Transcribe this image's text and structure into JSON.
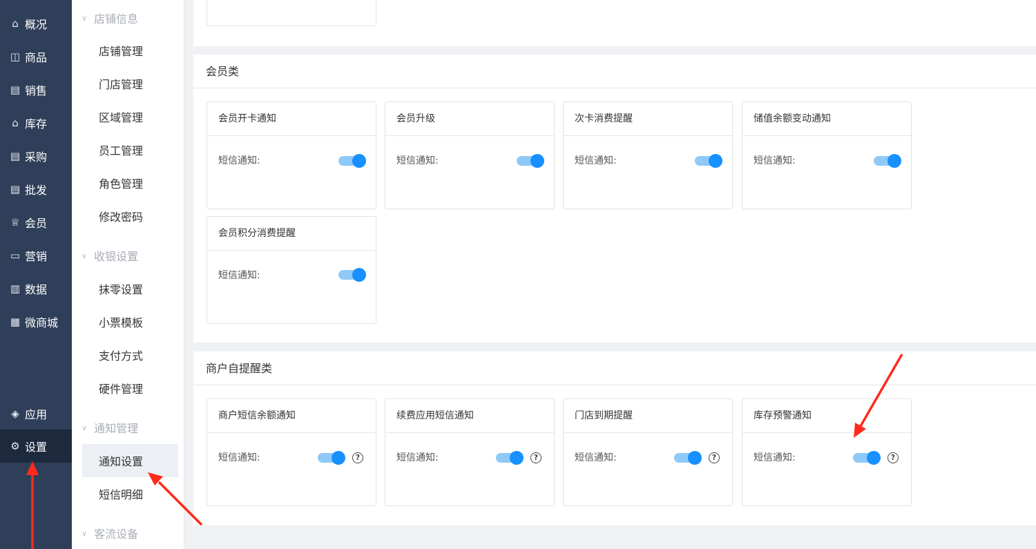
{
  "nav": {
    "items": [
      {
        "label": "概况",
        "icon": "overview-icon",
        "glyph": "⌂"
      },
      {
        "label": "商品",
        "icon": "bag-icon",
        "glyph": "◫"
      },
      {
        "label": "销售",
        "icon": "receipt-icon",
        "glyph": "▤"
      },
      {
        "label": "库存",
        "icon": "warehouse-icon",
        "glyph": "⌂"
      },
      {
        "label": "采购",
        "icon": "receipt-icon",
        "glyph": "▤"
      },
      {
        "label": "批发",
        "icon": "receipt-icon",
        "glyph": "▤"
      },
      {
        "label": "会员",
        "icon": "crown-icon",
        "glyph": "♕"
      },
      {
        "label": "营销",
        "icon": "card-icon",
        "glyph": "▭"
      },
      {
        "label": "数据",
        "icon": "bar-chart-icon",
        "glyph": "▥"
      },
      {
        "label": "微商城",
        "icon": "shop-icon",
        "glyph": "▦"
      }
    ],
    "bottom": [
      {
        "label": "应用",
        "icon": "cube-icon",
        "glyph": "◈"
      },
      {
        "label": "设置",
        "icon": "gear-icon",
        "glyph": "⚙"
      }
    ]
  },
  "menu": {
    "group_store": "店铺信息",
    "store_items": [
      "店铺管理",
      "门店管理",
      "区域管理",
      "员工管理",
      "角色管理",
      "修改密码"
    ],
    "group_cashier": "收银设置",
    "cashier_items": [
      "抹零设置",
      "小票模板",
      "支付方式",
      "硬件管理"
    ],
    "group_notify": "通知管理",
    "notify_items": [
      "通知设置",
      "短信明细"
    ],
    "group_traffic": "客流设备"
  },
  "member_section": {
    "title": "会员类",
    "cards": [
      {
        "title": "会员开卡通知",
        "label": "短信通知:",
        "enabled": true
      },
      {
        "title": "会员升级",
        "label": "短信通知:",
        "enabled": true
      },
      {
        "title": "次卡消费提醒",
        "label": "短信通知:",
        "enabled": true
      },
      {
        "title": "储值余额变动通知",
        "label": "短信通知:",
        "enabled": true
      },
      {
        "title": "会员积分消费提醒",
        "label": "短信通知:",
        "enabled": true
      }
    ]
  },
  "merchant_section": {
    "title": "商户自提醒类",
    "cards": [
      {
        "title": "商户短信余额通知",
        "label": "短信通知:",
        "enabled": true,
        "help": "?"
      },
      {
        "title": "续费应用短信通知",
        "label": "短信通知:",
        "enabled": true,
        "help": "?"
      },
      {
        "title": "门店到期提醒",
        "label": "短信通知:",
        "enabled": true,
        "help": "?"
      },
      {
        "title": "库存预警通知",
        "label": "短信通知:",
        "enabled": true,
        "help": "?"
      }
    ]
  },
  "colors": {
    "nav_bg": "#2f3f59",
    "nav_active": "#1d2a3e",
    "accent": "#1890ff",
    "annotation": "#ff2a1a"
  }
}
